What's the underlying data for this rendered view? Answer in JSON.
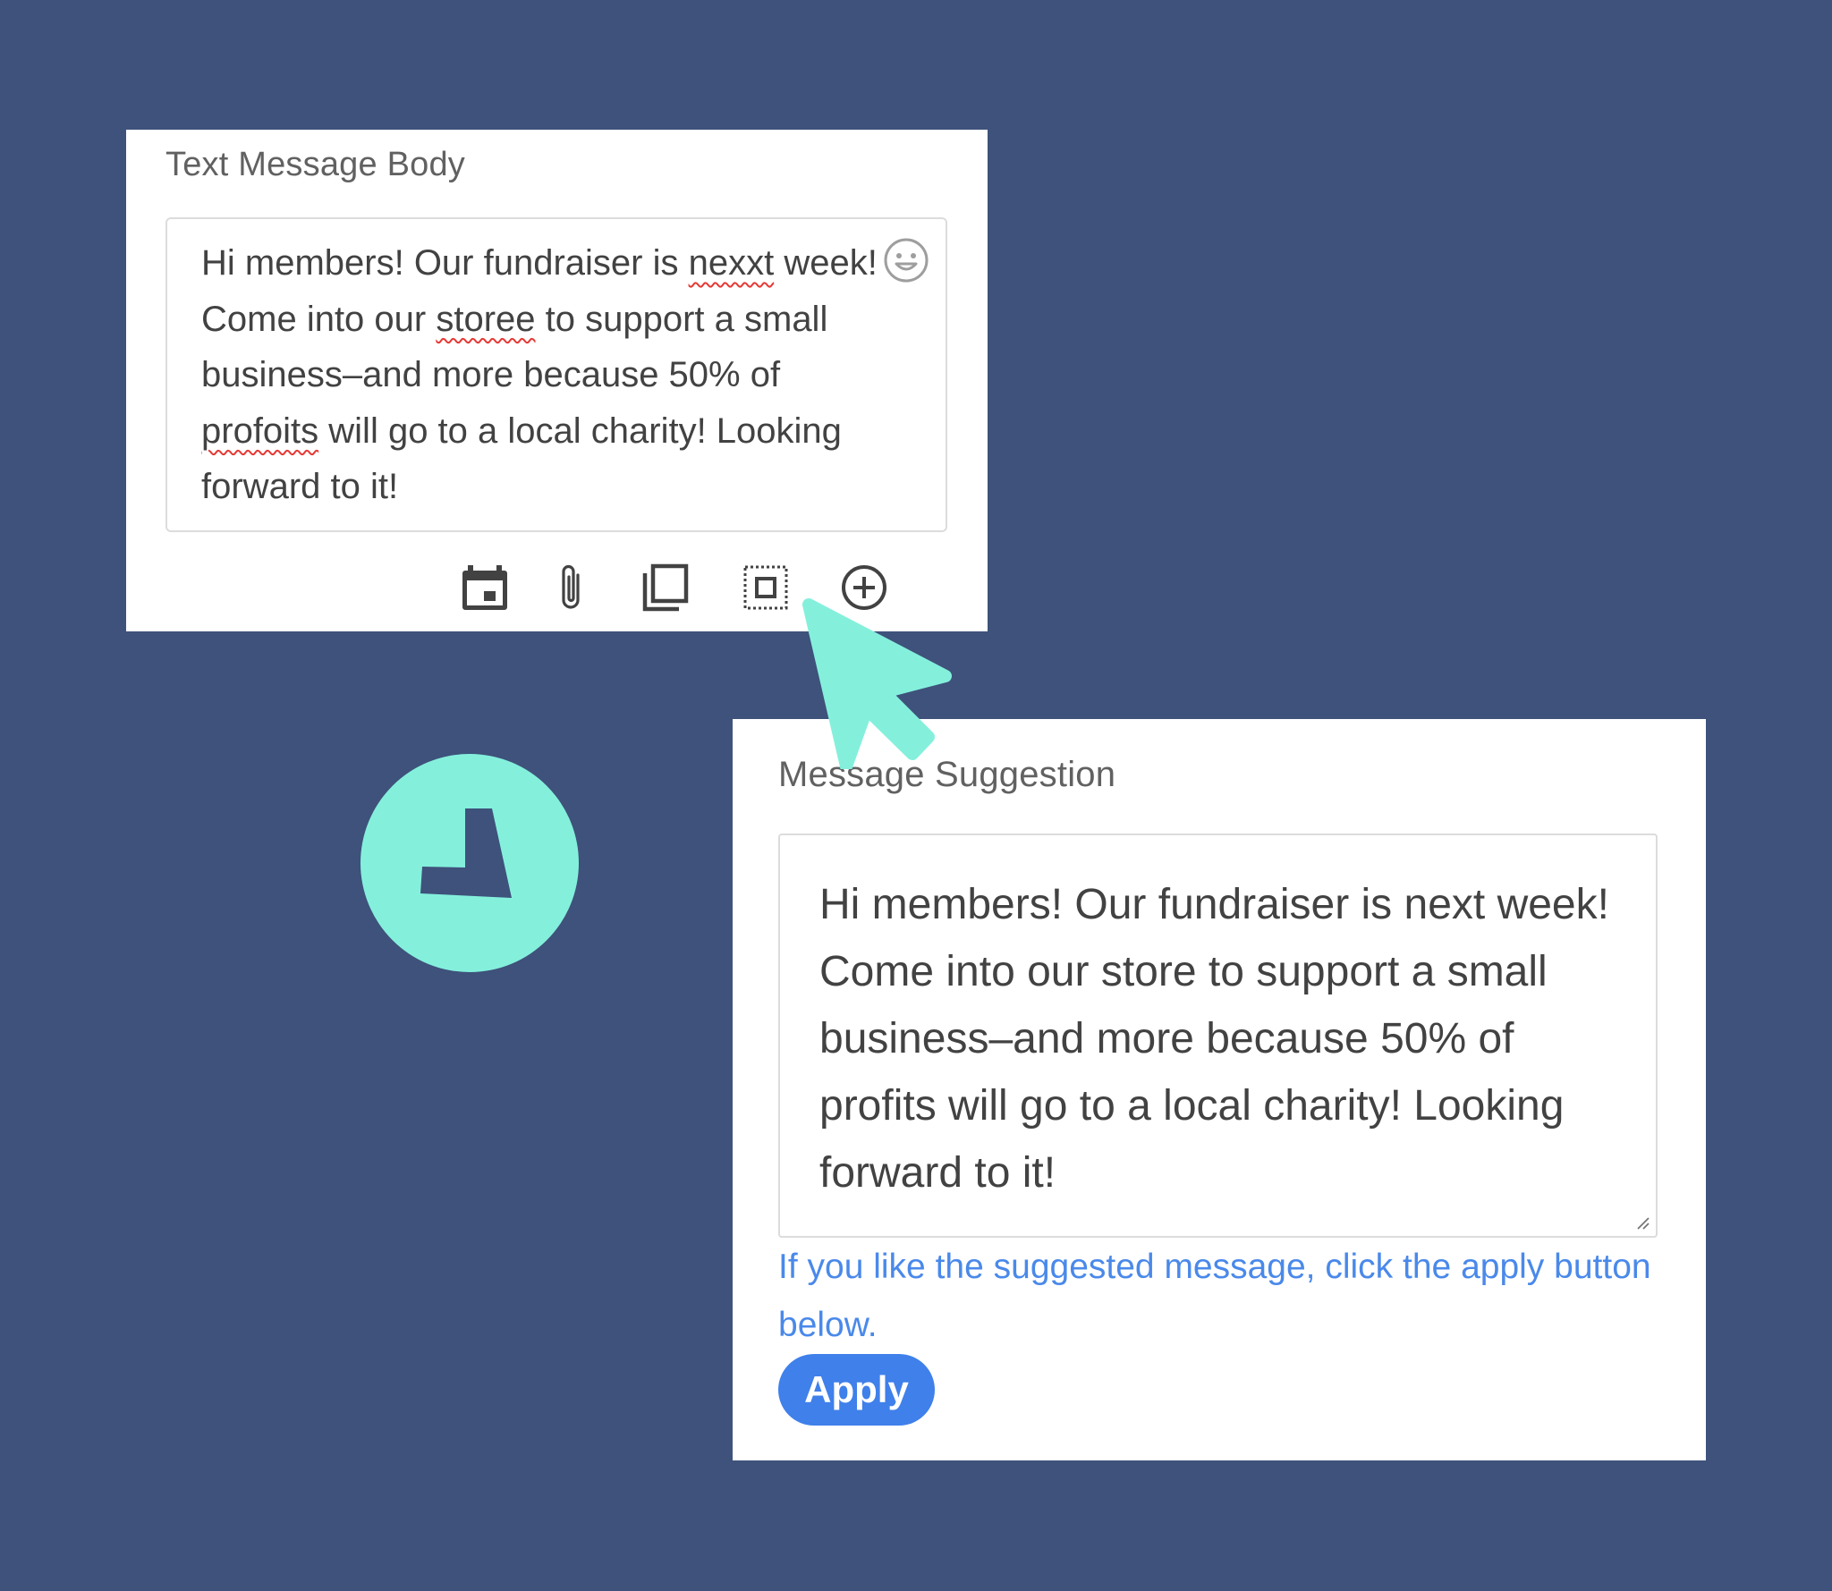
{
  "colors": {
    "background": "#3e527b",
    "panel": "#ffffff",
    "accent_mint": "#84f0dc",
    "link_blue": "#4a89ea",
    "button_blue": "#3f80ea",
    "misspelling": "#e53935"
  },
  "text_message": {
    "label": "Text Message Body",
    "body_parts": {
      "p1": "Hi members! Our fundraiser is ",
      "w1": "nexxt",
      "p2": " week! Come into our ",
      "w2": "storee",
      "p3": " to support a small business–and more because 50% of ",
      "w3": "profoits",
      "p4": " will go to a local charity! Looking forward to it!"
    },
    "emoji_icon": "smiley-face-icon",
    "toolbar": [
      "calendar-icon",
      "paperclip-icon",
      "copy-layers-icon",
      "select-frame-icon",
      "add-circle-icon"
    ]
  },
  "suggestion": {
    "label": "Message Suggestion",
    "text": "Hi members! Our fundraiser is next week! Come into our store to support a small business–and more because 50% of profits will go to a local charity! Looking forward to it!",
    "hint": "If you like the suggested message, click the apply button below.",
    "apply_label": "Apply"
  },
  "decorations": {
    "pointer": "cursor-arrow-icon",
    "logo": "brand-logo-icon"
  }
}
